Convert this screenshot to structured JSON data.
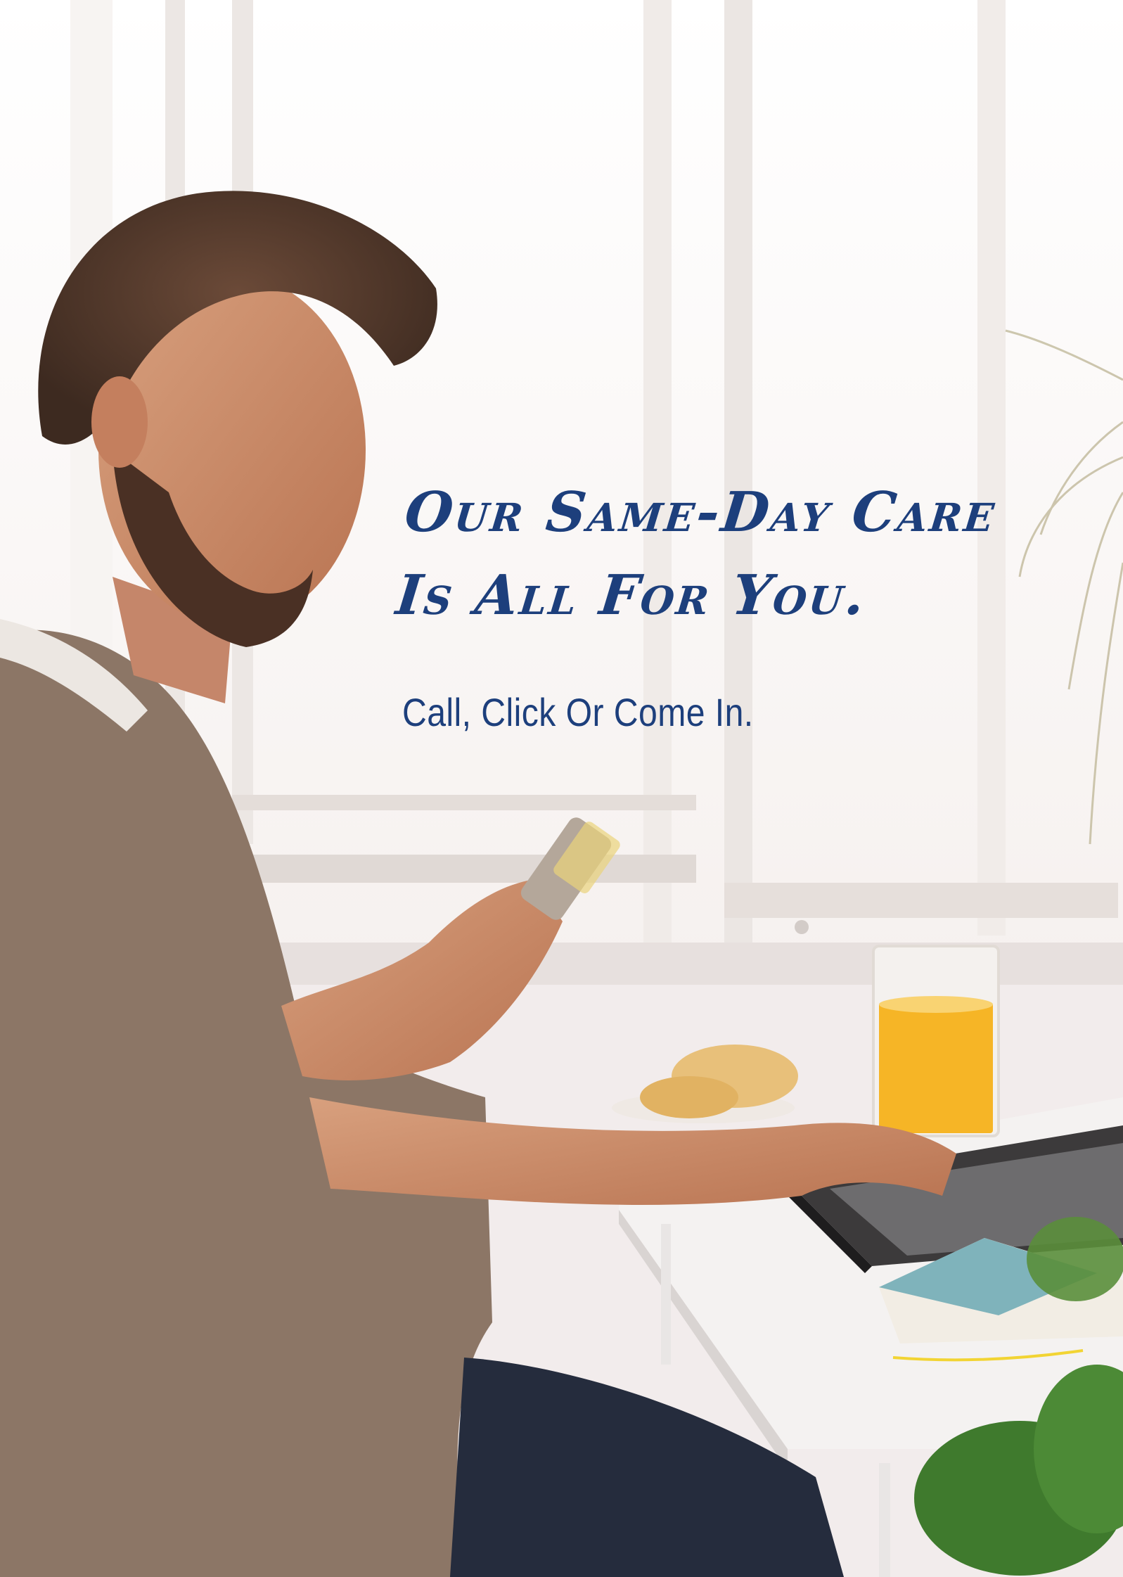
{
  "headline": {
    "line1": "Our Same-Day Care",
    "line2": "Is All For You."
  },
  "tagline": "Call, Click Or Come In.",
  "colors": {
    "text": "#1d3f7c",
    "window_light": "#fbf8f6",
    "wall": "#efe7e8",
    "sweater": "#8c7666",
    "juice": "#f6b526",
    "plant": "#3f7a2d"
  }
}
